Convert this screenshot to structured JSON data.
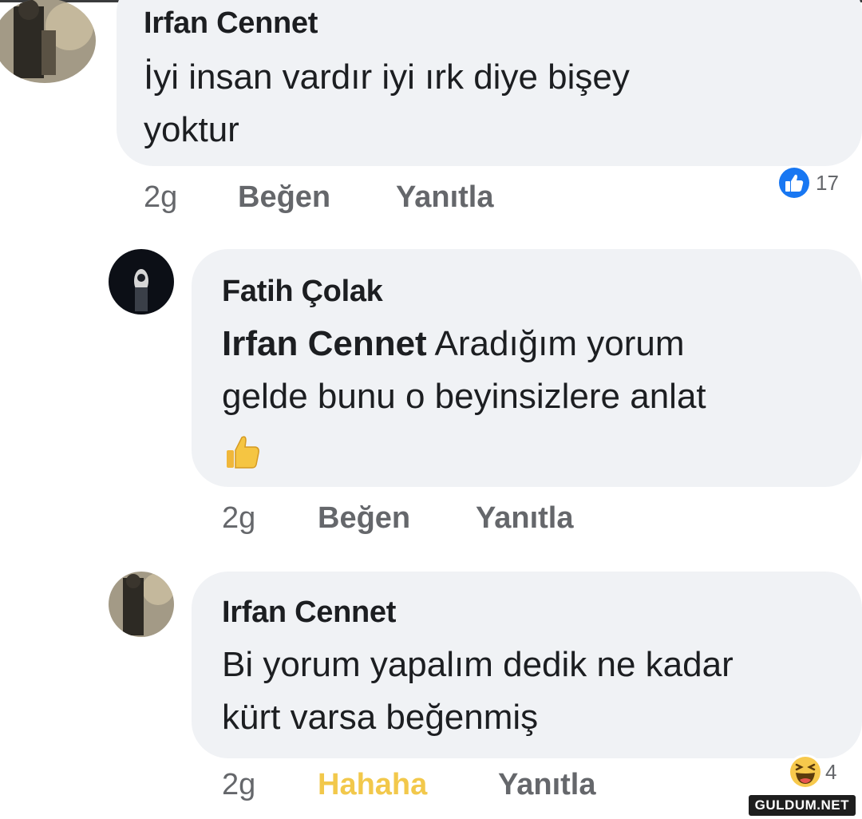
{
  "comments": [
    {
      "author": "Irfan Cennet",
      "line1": "İyi insan vardır iyi ırk diye bişey",
      "line2": "yoktur",
      "time": "2g",
      "like_label": "Beğen",
      "reply_label": "Yanıtla",
      "reaction_icon": "like-icon",
      "reaction_count": "17"
    },
    {
      "author": "Fatih Çolak",
      "mention": "Irfan Cennet",
      "line1_rest": " Aradığım yorum",
      "line2": "gelde bunu o beyinsizlere anlat",
      "emoji_icon": "thumbs-up-emoji-icon",
      "time": "2g",
      "like_label": "Beğen",
      "reply_label": "Yanıtla"
    },
    {
      "author": "Irfan Cennet",
      "line1": "Bi yorum yapalım dedik ne kadar",
      "line2": "kürt varsa beğenmiş",
      "time": "2g",
      "like_label": "Hahaha",
      "reply_label": "Yanıtla",
      "reaction_icon": "haha-icon",
      "reaction_count": "4"
    }
  ],
  "watermark": "GULDUM.NET",
  "colors": {
    "bubble": "#f0f2f5",
    "meta": "#65676b",
    "like_blue": "#1877f2",
    "haha_yellow": "#f2c84b"
  }
}
